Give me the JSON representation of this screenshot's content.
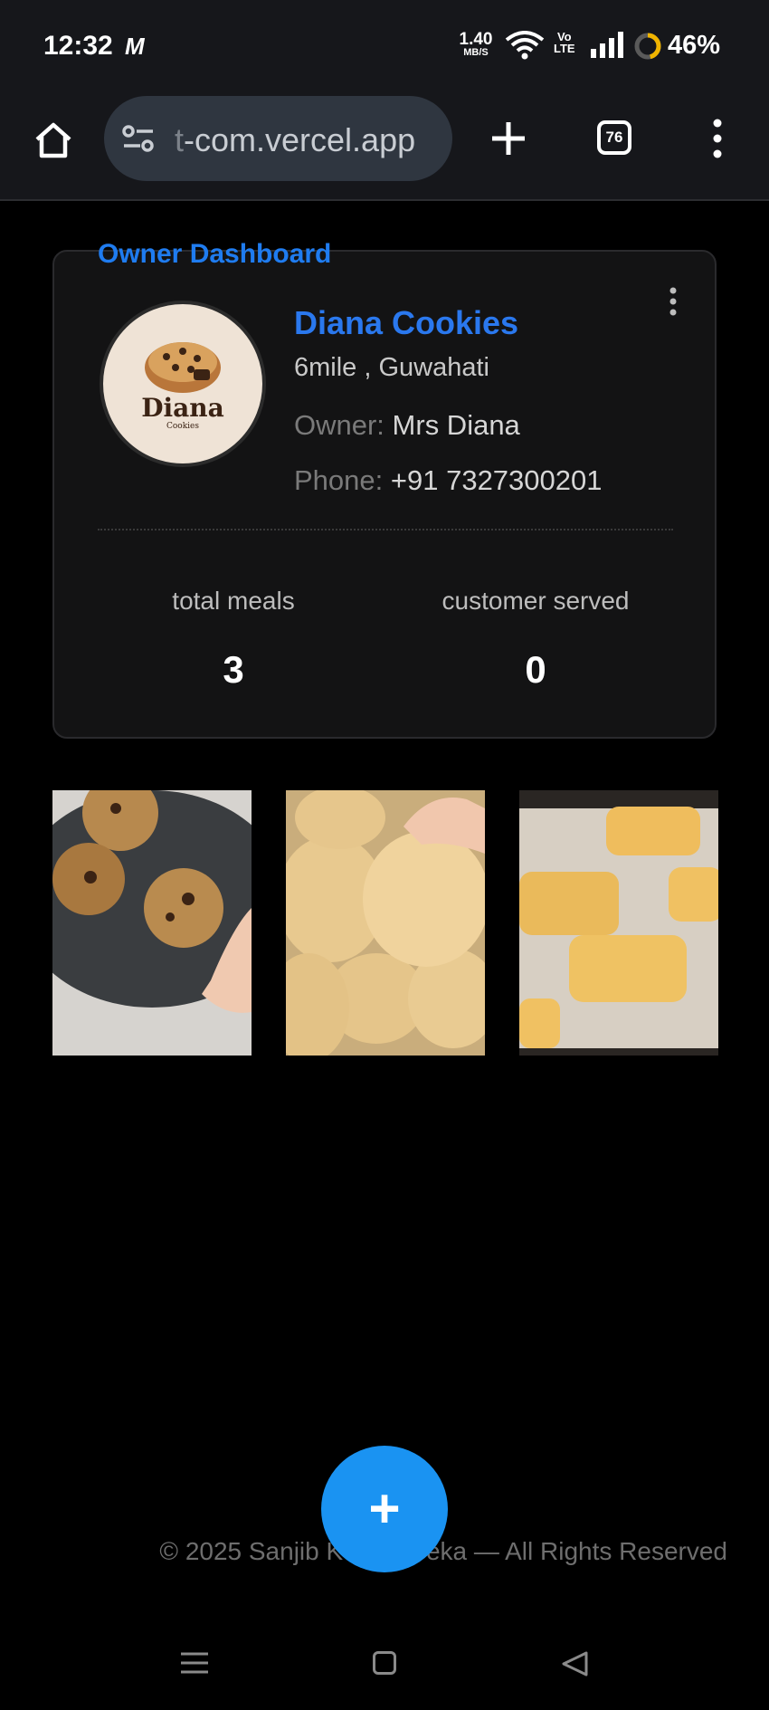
{
  "status_bar": {
    "time": "12:32",
    "carrier_icon": "M",
    "net_speed_value": "1.40",
    "net_speed_unit": "MB/S",
    "volte_top": "Vo",
    "volte_bottom": "LTE",
    "battery": "46%",
    "battery_level": 0.46
  },
  "browser": {
    "url_dim": "t",
    "url": "-com.vercel.app",
    "tab_count": "76"
  },
  "dashboard": {
    "title": "Owner Dashboard",
    "avatar_word": "Diana",
    "avatar_sub": "Cookies",
    "shop_name": "Diana Cookies",
    "location": "6mile , Guwahati",
    "owner_label": "Owner:",
    "owner_name": "Mrs Diana",
    "phone_label": "Phone:",
    "phone": "+91 7327300201",
    "stats": [
      {
        "label": "total meals",
        "value": "3"
      },
      {
        "label": "customer served",
        "value": "0"
      }
    ]
  },
  "gallery": {
    "items": [
      {
        "name": "chocolate chip cookies on plate"
      },
      {
        "name": "butter cookies pile"
      },
      {
        "name": "cookies on baking tray"
      }
    ]
  },
  "footer": {
    "text": "© 2025 Sanjib Kumar Deka — All Rights Reserved"
  },
  "fab": {
    "label": "+"
  },
  "colors": {
    "accent": "#1f7cf0",
    "fab": "#1a93f2",
    "background": "#000000",
    "card": "#131314"
  }
}
